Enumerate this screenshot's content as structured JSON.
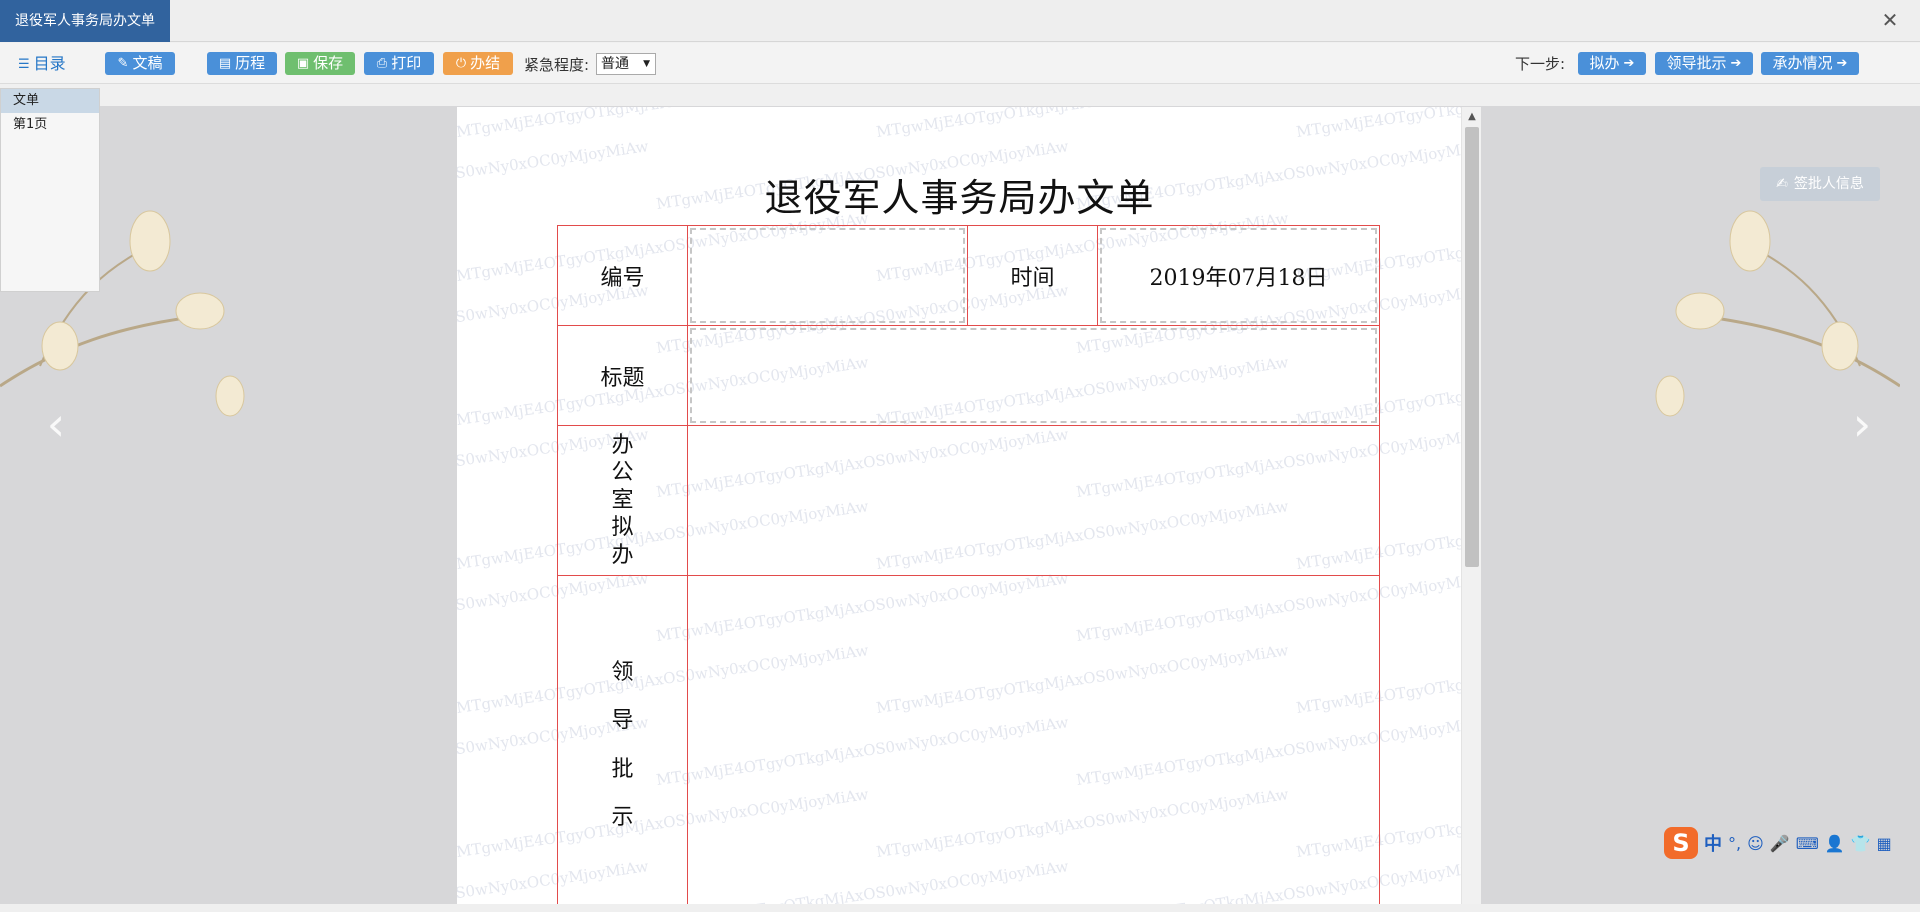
{
  "window": {
    "title": "退役军人事务局办文单",
    "close_icon": "close-icon"
  },
  "toolbar": {
    "catalog_label": "目录",
    "draft_label": "文稿",
    "history_label": "历程",
    "save_label": "保存",
    "print_label": "打印",
    "finish_label": "办结",
    "urgency_label": "紧急程度:",
    "urgency_value": "普通",
    "next_step_label": "下一步:",
    "next_buttons": [
      "拟办",
      "领导批示",
      "承办情况"
    ]
  },
  "sidebar": {
    "items": [
      "文单",
      "第1页"
    ]
  },
  "signer_button": "签批人信息",
  "document": {
    "title": "退役军人事务局办文单",
    "rows": {
      "number_label": "编号",
      "number_value": "",
      "time_label": "时间",
      "time_value": "2019年07月18日",
      "subject_label": "标题",
      "subject_value": "",
      "office_label_chars": [
        "办",
        "公",
        "室",
        "拟",
        "办"
      ],
      "leader_label_chars": [
        "领",
        "导",
        "批",
        "示"
      ]
    },
    "watermark_text": "MTgwMjE4OTgyOTkgMjAxOS0wNy0xOC0yMjoyMiAw"
  },
  "ime": {
    "logo": "S",
    "mode": "中",
    "punct": "°,"
  },
  "colors": {
    "title_tab": "#31639e",
    "table_border": "#e24b4b",
    "button_blue": "#4a90d9",
    "button_green": "#6fbf6f",
    "button_orange": "#f0a04b"
  }
}
